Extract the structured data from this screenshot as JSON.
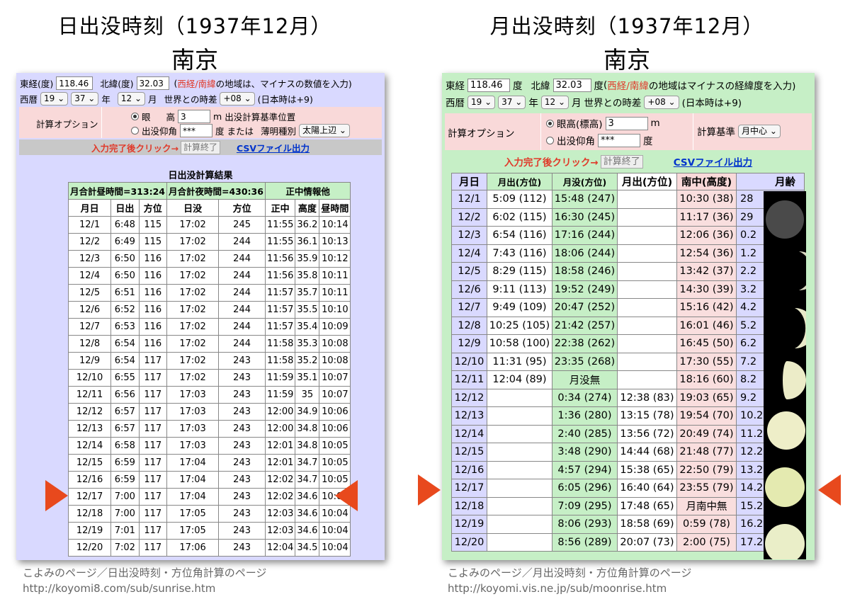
{
  "left": {
    "title": "日出没時刻（1937年12月）",
    "city": "南京",
    "form": {
      "lng_label": "東経(度)",
      "lng": "118.46",
      "lat_label": "北緯(度)",
      "lat": "32.03",
      "note_red": "西経/南緯",
      "note_rest": "の地域は、マイナスの数値を入力)",
      "note_open": "(",
      "era": "西暦",
      "year_a": "19",
      "year_b": "37",
      "year_unit": "年",
      "month": "12",
      "month_unit": "月",
      "tz_label": "世界との時差",
      "tz": "+08",
      "tz_note": "(日本時は+9)"
    },
    "options": {
      "label": "計算オプション",
      "eye": "眼",
      "eye_h": "高",
      "height": "3",
      "unit": "m",
      "base": "出没計算基準位置",
      "angle": "出没仰角",
      "angle_val": "***",
      "deg": "度",
      "or": "または",
      "twilight": "薄明種別",
      "twilight_val": "太陽上辺"
    },
    "actions": {
      "hint": "入力完了後クリック→",
      "done": "計算終了",
      "csv": "CSVファイル出力"
    },
    "result_title": "日出没計算結果",
    "summary": [
      "月合計昼時間=313:24",
      "月合計夜時間=430:36",
      "正中情報他"
    ],
    "headers": [
      "月日",
      "日出",
      "方位",
      "日没",
      "方位",
      "正中",
      "高度",
      "昼時間"
    ],
    "rows": [
      [
        "12/1",
        "6:48",
        "115",
        "17:02",
        "245",
        "11:55",
        "36.2",
        "10:14"
      ],
      [
        "12/2",
        "6:49",
        "115",
        "17:02",
        "244",
        "11:55",
        "36.1",
        "10:13"
      ],
      [
        "12/3",
        "6:50",
        "116",
        "17:02",
        "244",
        "11:56",
        "35.9",
        "10:12"
      ],
      [
        "12/4",
        "6:50",
        "116",
        "17:02",
        "244",
        "11:56",
        "35.8",
        "10:11"
      ],
      [
        "12/5",
        "6:51",
        "116",
        "17:02",
        "244",
        "11:57",
        "35.7",
        "10:11"
      ],
      [
        "12/6",
        "6:52",
        "116",
        "17:02",
        "244",
        "11:57",
        "35.5",
        "10:10"
      ],
      [
        "12/7",
        "6:53",
        "116",
        "17:02",
        "244",
        "11:57",
        "35.4",
        "10:09"
      ],
      [
        "12/8",
        "6:54",
        "116",
        "17:02",
        "244",
        "11:58",
        "35.3",
        "10:08"
      ],
      [
        "12/9",
        "6:54",
        "117",
        "17:02",
        "243",
        "11:58",
        "35.2",
        "10:08"
      ],
      [
        "12/10",
        "6:55",
        "117",
        "17:02",
        "243",
        "11:59",
        "35.1",
        "10:07"
      ],
      [
        "12/11",
        "6:56",
        "117",
        "17:03",
        "243",
        "11:59",
        "35",
        "10:07"
      ],
      [
        "12/12",
        "6:57",
        "117",
        "17:03",
        "243",
        "12:00",
        "34.9",
        "10:06"
      ],
      [
        "12/13",
        "6:57",
        "117",
        "17:03",
        "243",
        "12:00",
        "34.8",
        "10:06"
      ],
      [
        "12/14",
        "6:58",
        "117",
        "17:03",
        "243",
        "12:01",
        "34.8",
        "10:05"
      ],
      [
        "12/15",
        "6:59",
        "117",
        "17:04",
        "243",
        "12:01",
        "34.7",
        "10:05"
      ],
      [
        "12/16",
        "6:59",
        "117",
        "17:04",
        "243",
        "12:02",
        "34.7",
        "10:05"
      ],
      [
        "12/17",
        "7:00",
        "117",
        "17:04",
        "243",
        "12:02",
        "34.6",
        "10:04"
      ],
      [
        "12/18",
        "7:00",
        "117",
        "17:05",
        "243",
        "12:03",
        "34.6",
        "10:04"
      ],
      [
        "12/19",
        "7:01",
        "117",
        "17:05",
        "243",
        "12:03",
        "34.6",
        "10:04"
      ],
      [
        "12/20",
        "7:02",
        "117",
        "17:06",
        "243",
        "12:04",
        "34.5",
        "10:04"
      ]
    ],
    "caption1": "こよみのページ／日出没時刻・方位角計算のページ",
    "caption2": "http://koyomi8.com/sub/sunrise.htm"
  },
  "right": {
    "title": "月出没時刻（1937年12月）",
    "city": "南京",
    "form": {
      "lng_label": "東経",
      "lng": "118.46",
      "deg1": "度",
      "lat_label": "北緯",
      "lat": "32.03",
      "deg2": "度",
      "note_open": "(",
      "note_red": "西経/南緯",
      "note_rest": "の地域はマイナスの経緯度を入力)",
      "era": "西暦",
      "year_a": "19",
      "year_b": "37",
      "year_unit": "年",
      "month": "12",
      "month_unit": "月",
      "tz_label": "世界との時差",
      "tz": "+08",
      "tz_note": "(日本時は+9)"
    },
    "options": {
      "label": "計算オプション",
      "eye": "眼高(標高)",
      "height": "3",
      "unit": "m",
      "angle": "出没仰角",
      "angle_val": "***",
      "deg": "度",
      "base_label": "計算基準",
      "base_val": "月中心"
    },
    "actions": {
      "hint": "入力完了後クリック→",
      "done": "計算終了",
      "csv": "CSVファイル出力"
    },
    "headers": [
      "月日",
      "月出(方位)",
      "月没(方位)",
      "月出(方位)",
      "南中(高度)",
      "月齢"
    ],
    "rows": [
      [
        "12/1",
        "5:09 (112)",
        "15:48 (247)",
        "",
        "10:30 (38)",
        "28"
      ],
      [
        "12/2",
        "6:02 (115)",
        "16:30 (245)",
        "",
        "11:17 (36)",
        "29"
      ],
      [
        "12/3",
        "6:54 (116)",
        "17:16 (244)",
        "",
        "12:06 (36)",
        "0.2"
      ],
      [
        "12/4",
        "7:43 (116)",
        "18:06 (244)",
        "",
        "12:54 (36)",
        "1.2"
      ],
      [
        "12/5",
        "8:29 (115)",
        "18:58 (246)",
        "",
        "13:42 (37)",
        "2.2"
      ],
      [
        "12/6",
        "9:11 (113)",
        "19:52 (249)",
        "",
        "14:30 (39)",
        "3.2"
      ],
      [
        "12/7",
        "9:49 (109)",
        "20:47 (252)",
        "",
        "15:16 (42)",
        "4.2"
      ],
      [
        "12/8",
        "10:25 (105)",
        "21:42 (257)",
        "",
        "16:01 (46)",
        "5.2"
      ],
      [
        "12/9",
        "10:58 (100)",
        "22:38 (262)",
        "",
        "16:45 (50)",
        "6.2"
      ],
      [
        "12/10",
        "11:31 (95)",
        "23:35 (268)",
        "",
        "17:30 (55)",
        "7.2"
      ],
      [
        "12/11",
        "12:04 (89)",
        "月没無",
        "",
        "18:16 (60)",
        "8.2"
      ],
      [
        "12/12",
        "",
        "0:34 (274)",
        "12:38 (83)",
        "19:03 (65)",
        "9.2"
      ],
      [
        "12/13",
        "",
        "1:36 (280)",
        "13:15 (78)",
        "19:54 (70)",
        "10.2"
      ],
      [
        "12/14",
        "",
        "2:40 (285)",
        "13:56 (72)",
        "20:49 (74)",
        "11.2"
      ],
      [
        "12/15",
        "",
        "3:48 (290)",
        "14:44 (68)",
        "21:48 (77)",
        "12.2"
      ],
      [
        "12/16",
        "",
        "4:57 (294)",
        "15:38 (65)",
        "22:50 (79)",
        "13.2"
      ],
      [
        "12/17",
        "",
        "6:05 (296)",
        "16:40 (64)",
        "23:55 (79)",
        "14.2"
      ],
      [
        "12/18",
        "",
        "7:09 (295)",
        "17:48 (65)",
        "月南中無",
        "15.2"
      ],
      [
        "12/19",
        "",
        "8:06 (293)",
        "18:58 (69)",
        "0:59 (78)",
        "16.2"
      ],
      [
        "12/20",
        "",
        "8:56 (289)",
        "20:07 (73)",
        "2:00 (75)",
        "17.2"
      ]
    ],
    "caption1": "こよみのページ／月出没時刻・方位角計算のページ",
    "caption2": "http://koyomi.vis.ne.jp/sub/moonrise.htm"
  },
  "colors": {
    "arrow": "#e8491d",
    "left_bg": "#d9d9ff",
    "right_bg": "#c6efc6",
    "highlight": "#f9d9d9"
  }
}
